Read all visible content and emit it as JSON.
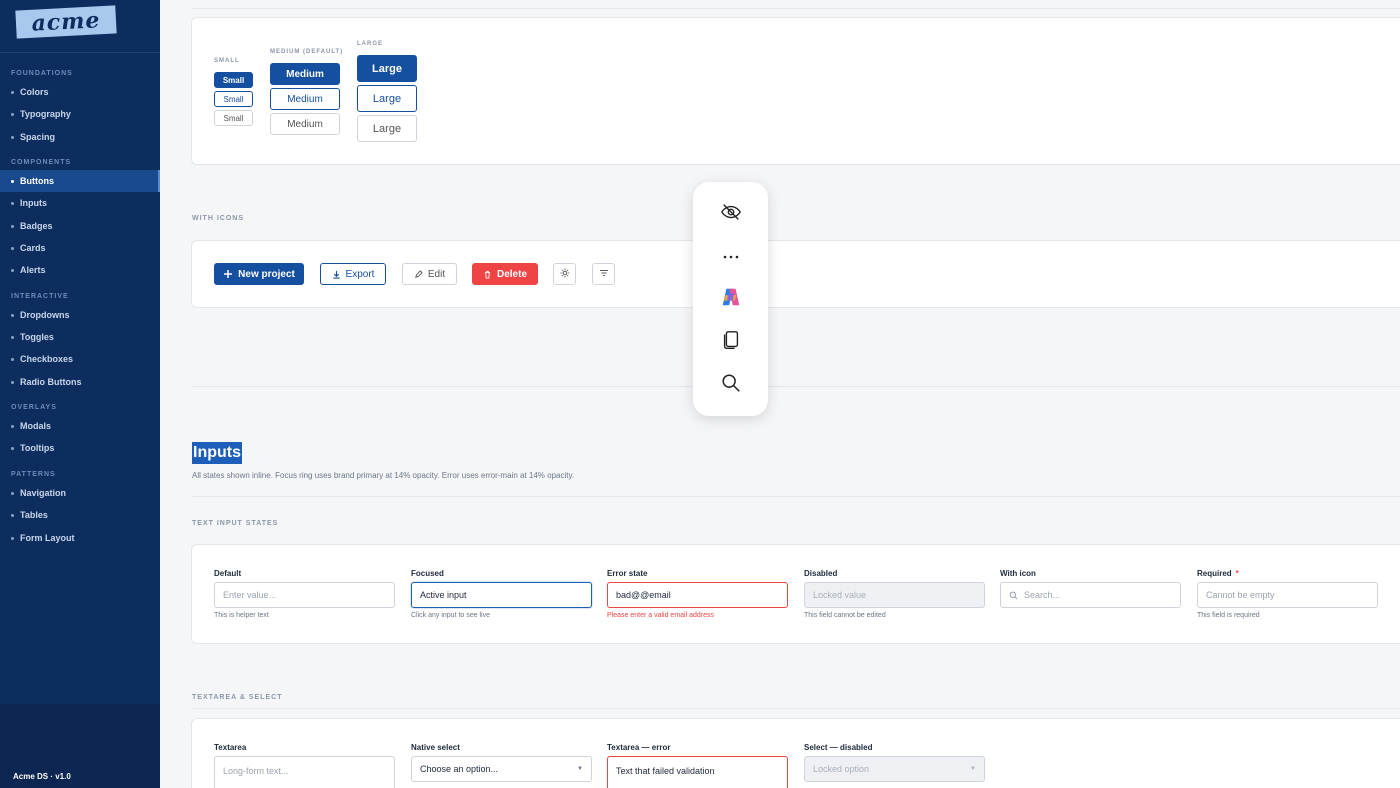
{
  "sidebar": {
    "logo": "acme",
    "sections": [
      {
        "title": "FOUNDATIONS",
        "items": [
          "Colors",
          "Typography",
          "Spacing"
        ]
      },
      {
        "title": "COMPONENTS",
        "items": [
          "Buttons",
          "Inputs",
          "Badges",
          "Cards",
          "Alerts"
        ]
      },
      {
        "title": "INTERACTIVE",
        "items": [
          "Dropdowns",
          "Toggles",
          "Checkboxes",
          "Radio Buttons"
        ]
      },
      {
        "title": "OVERLAYS",
        "items": [
          "Modals",
          "Tooltips"
        ]
      },
      {
        "title": "PATTERNS",
        "items": [
          "Navigation",
          "Tables",
          "Form Layout"
        ]
      }
    ],
    "active_item": "Buttons",
    "footer": "Acme DS · v1.0"
  },
  "sizes": {
    "small_label": "SMALL",
    "medium_label": "MEDIUM (DEFAULT)",
    "large_label": "LARGE",
    "small_btn": "Small",
    "medium_btn": "Medium",
    "large_btn": "Large"
  },
  "with_icons": {
    "label": "WITH ICONS",
    "new_project": "New project",
    "export": "Export",
    "edit": "Edit",
    "delete": "Delete"
  },
  "inputs": {
    "title": "Inputs",
    "subtitle": "All states shown inline. Focus ring uses brand primary at 14% opacity. Error uses error-main at 14% opacity.",
    "text_states_label": "TEXT INPUT STATES",
    "fields": [
      {
        "label": "Default",
        "value": "Enter value...",
        "helper": "This is helper text"
      },
      {
        "label": "Focused",
        "value": "Active input",
        "helper": "Click any input to see live"
      },
      {
        "label": "Error state",
        "value": "bad@@email",
        "helper": "Please enter a valid email address"
      },
      {
        "label": "Disabled",
        "value": "Locked value",
        "helper": "This field cannot be edited"
      },
      {
        "label": "With icon",
        "value": "Search...",
        "helper": ""
      },
      {
        "label": "Required",
        "required_mark": "*",
        "value": "Cannot be empty",
        "helper": "This field is required"
      }
    ],
    "textarea_label": "TEXTAREA & SELECT",
    "textarea_fields": [
      {
        "label": "Textarea",
        "value": "Long-form text..."
      },
      {
        "label": "Native select",
        "value": "Choose an option..."
      },
      {
        "label": "Textarea — error",
        "value": "Text that failed validation"
      },
      {
        "label": "Select — disabled",
        "value": "Locked option"
      }
    ]
  },
  "floating_toolbar": {
    "icons": [
      "eye-off-icon",
      "more-icon",
      "copilot-icon",
      "copy-icon",
      "search-icon"
    ]
  },
  "colors": {
    "primary": "#154fa0",
    "sidebar": "#0d2d5e",
    "danger": "#ef4444"
  }
}
